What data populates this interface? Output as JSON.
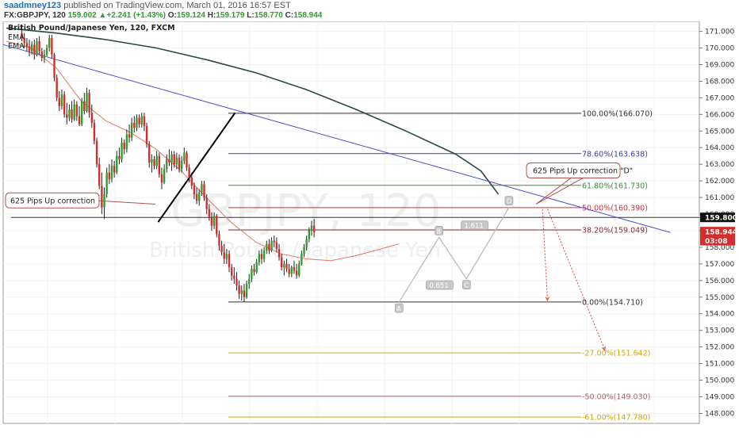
{
  "header": {
    "author": "saadmney123",
    "published": "published on TradingView.com, March 01, 2016 16:57 EST",
    "symbol_tf": "FX:GBPJPY, 120",
    "price": "159.002",
    "change": "+2.241 (+1.43%)",
    "open_label": "O:",
    "open": "159.124",
    "high_label": "H:",
    "high": "159.179",
    "low_label": "L:",
    "low": "158.770",
    "close_label": "C:",
    "close": "158.944"
  },
  "chart_data": {
    "type": "candlestick",
    "title": "British Pound/Japanese Yen, 120, FXCM",
    "legend": [
      "EMA",
      "EMA"
    ],
    "watermark": {
      "main": "GBPJPY, 120",
      "sub": "British Pound / Japanese Yen"
    },
    "ylim": [
      147.4,
      171.6
    ],
    "yticks": [
      148,
      149,
      150,
      151,
      152,
      153,
      154,
      155,
      156,
      157,
      158,
      159,
      160,
      161,
      162,
      163,
      164,
      165,
      166,
      167,
      168,
      169,
      170,
      171
    ],
    "ytick_labels": [
      "148.000",
      "149.000",
      "150.000",
      "151.000",
      "152.000",
      "153.000",
      "154.000",
      "155.000",
      "156.000",
      "157.000",
      "158.000",
      "159.000",
      "160.000",
      "161.000",
      "162.000",
      "163.000",
      "164.000",
      "165.000",
      "166.000",
      "167.000",
      "168.000",
      "169.000",
      "170.000",
      "171.000"
    ],
    "price_tags": [
      {
        "value": 159.8,
        "label": "159.800",
        "style": "black"
      },
      {
        "value": 158.944,
        "label": "158.944",
        "style": "red"
      },
      {
        "value": 158.4,
        "label": "03:08",
        "style": "red"
      }
    ],
    "candles": [
      [
        170.9,
        171.4,
        170.4,
        170.6
      ],
      [
        170.6,
        170.9,
        170.0,
        170.3
      ],
      [
        170.3,
        170.6,
        169.8,
        170.1
      ],
      [
        170.1,
        170.5,
        169.5,
        169.8
      ],
      [
        169.8,
        170.4,
        169.6,
        170.2
      ],
      [
        170.2,
        170.5,
        169.3,
        169.6
      ],
      [
        169.6,
        170.6,
        169.5,
        170.4
      ],
      [
        170.4,
        170.7,
        169.6,
        169.8
      ],
      [
        169.8,
        170.0,
        169.2,
        169.4
      ],
      [
        169.4,
        169.9,
        169.1,
        169.6
      ],
      [
        169.6,
        170.2,
        169.5,
        170.0
      ],
      [
        170.0,
        170.8,
        169.8,
        170.6
      ],
      [
        170.6,
        170.8,
        169.4,
        169.6
      ],
      [
        169.6,
        169.7,
        168.0,
        168.2
      ],
      [
        168.2,
        168.4,
        166.8,
        167.0
      ],
      [
        167.0,
        167.4,
        166.2,
        166.5
      ],
      [
        166.5,
        167.5,
        166.3,
        167.2
      ],
      [
        167.2,
        167.4,
        165.8,
        166.0
      ],
      [
        166.0,
        166.7,
        165.4,
        165.8
      ],
      [
        165.8,
        166.6,
        165.6,
        166.3
      ],
      [
        166.3,
        166.8,
        165.5,
        165.7
      ],
      [
        165.7,
        166.9,
        165.6,
        166.6
      ],
      [
        166.6,
        166.8,
        165.6,
        165.9
      ],
      [
        165.9,
        166.5,
        165.3,
        165.4
      ],
      [
        165.4,
        167.0,
        165.3,
        166.8
      ],
      [
        166.8,
        167.3,
        166.0,
        166.2
      ],
      [
        166.2,
        167.6,
        166.1,
        167.3
      ],
      [
        167.3,
        167.5,
        165.8,
        166.1
      ],
      [
        166.1,
        166.6,
        165.2,
        165.5
      ],
      [
        165.5,
        165.7,
        164.2,
        164.4
      ],
      [
        164.4,
        164.6,
        162.8,
        163.0
      ],
      [
        163.0,
        163.4,
        161.5,
        161.7
      ],
      [
        161.7,
        162.5,
        160.0,
        160.4
      ],
      [
        160.4,
        161.6,
        159.7,
        161.2
      ],
      [
        161.2,
        162.8,
        161.0,
        162.5
      ],
      [
        162.5,
        163.0,
        161.8,
        162.1
      ],
      [
        162.1,
        163.3,
        161.9,
        162.9
      ],
      [
        162.9,
        163.2,
        162.2,
        162.5
      ],
      [
        162.5,
        163.8,
        162.4,
        163.5
      ],
      [
        163.5,
        164.0,
        163.0,
        163.3
      ],
      [
        163.3,
        164.6,
        163.1,
        164.3
      ],
      [
        164.3,
        164.5,
        163.6,
        163.9
      ],
      [
        163.9,
        165.1,
        163.7,
        164.8
      ],
      [
        164.8,
        165.4,
        164.3,
        164.6
      ],
      [
        164.6,
        165.8,
        164.4,
        165.5
      ],
      [
        165.5,
        165.9,
        164.9,
        165.2
      ],
      [
        165.2,
        166.0,
        165.0,
        165.8
      ],
      [
        165.8,
        166.0,
        165.2,
        165.4
      ],
      [
        165.4,
        166.1,
        165.2,
        165.9
      ],
      [
        165.9,
        166.1,
        165.0,
        165.3
      ],
      [
        165.3,
        165.5,
        164.0,
        164.2
      ],
      [
        164.2,
        164.4,
        162.8,
        163.1
      ],
      [
        163.1,
        163.6,
        162.5,
        163.3
      ],
      [
        163.3,
        163.5,
        162.7,
        162.9
      ],
      [
        162.9,
        163.8,
        162.7,
        163.5
      ],
      [
        163.5,
        163.7,
        162.2,
        162.4
      ],
      [
        162.4,
        162.8,
        161.5,
        161.9
      ],
      [
        161.9,
        163.0,
        161.8,
        162.7
      ],
      [
        162.7,
        163.6,
        162.5,
        163.3
      ],
      [
        163.3,
        163.9,
        162.9,
        163.1
      ],
      [
        163.1,
        163.8,
        162.6,
        163.6
      ],
      [
        163.6,
        163.8,
        162.8,
        163.0
      ],
      [
        163.0,
        163.7,
        162.7,
        163.4
      ],
      [
        163.4,
        163.6,
        162.5,
        162.7
      ],
      [
        162.7,
        163.5,
        162.5,
        163.2
      ],
      [
        163.2,
        164.0,
        163.0,
        163.7
      ],
      [
        163.7,
        163.8,
        162.6,
        162.8
      ],
      [
        162.8,
        163.0,
        161.9,
        162.2
      ],
      [
        162.2,
        162.5,
        161.5,
        161.7
      ],
      [
        161.7,
        161.9,
        160.9,
        161.2
      ],
      [
        161.2,
        161.6,
        160.6,
        160.8
      ],
      [
        160.8,
        161.5,
        160.5,
        161.3
      ],
      [
        161.3,
        162.0,
        161.1,
        161.8
      ],
      [
        161.8,
        162.0,
        160.8,
        161.0
      ],
      [
        161.0,
        161.2,
        160.0,
        160.3
      ],
      [
        160.3,
        160.6,
        159.6,
        159.8
      ],
      [
        159.8,
        160.1,
        159.0,
        159.3
      ],
      [
        159.3,
        160.1,
        159.1,
        159.9
      ],
      [
        159.9,
        160.0,
        158.6,
        158.8
      ],
      [
        158.8,
        159.0,
        157.8,
        158.1
      ],
      [
        158.1,
        158.4,
        157.5,
        157.7
      ],
      [
        157.7,
        158.2,
        157.0,
        157.3
      ],
      [
        157.3,
        157.9,
        157.0,
        157.6
      ],
      [
        157.6,
        157.8,
        156.5,
        156.8
      ],
      [
        156.8,
        157.0,
        156.0,
        156.3
      ],
      [
        156.3,
        156.8,
        155.8,
        156.1
      ],
      [
        156.1,
        156.5,
        155.4,
        155.7
      ],
      [
        155.7,
        156.0,
        154.9,
        155.2
      ],
      [
        155.2,
        155.7,
        154.8,
        155.4
      ],
      [
        155.4,
        155.8,
        154.7,
        155.0
      ],
      [
        155.0,
        156.0,
        154.9,
        155.8
      ],
      [
        155.8,
        156.4,
        155.5,
        156.1
      ],
      [
        156.1,
        156.9,
        155.9,
        156.7
      ],
      [
        156.7,
        157.0,
        156.3,
        156.5
      ],
      [
        156.5,
        157.3,
        156.4,
        157.1
      ],
      [
        157.1,
        157.8,
        156.9,
        157.6
      ],
      [
        157.6,
        157.9,
        157.0,
        157.3
      ],
      [
        157.3,
        158.0,
        157.1,
        157.8
      ],
      [
        157.8,
        158.4,
        157.6,
        158.2
      ],
      [
        158.2,
        158.5,
        157.6,
        157.8
      ],
      [
        157.8,
        158.6,
        157.7,
        158.4
      ],
      [
        158.4,
        158.7,
        158.0,
        158.3
      ],
      [
        158.3,
        158.6,
        157.7,
        157.9
      ],
      [
        157.9,
        158.2,
        157.2,
        157.4
      ],
      [
        157.4,
        157.6,
        156.6,
        156.8
      ],
      [
        156.8,
        157.2,
        156.3,
        157.0
      ],
      [
        157.0,
        157.3,
        156.5,
        156.7
      ],
      [
        156.7,
        157.0,
        156.2,
        156.4
      ],
      [
        156.4,
        156.9,
        156.2,
        156.8
      ],
      [
        156.8,
        157.2,
        156.4,
        156.6
      ],
      [
        156.6,
        157.0,
        156.1,
        156.3
      ],
      [
        156.3,
        157.2,
        156.2,
        157.0
      ],
      [
        157.0,
        157.8,
        156.9,
        157.6
      ],
      [
        157.6,
        158.2,
        157.4,
        158.0
      ],
      [
        158.0,
        158.7,
        157.8,
        158.5
      ],
      [
        158.5,
        159.2,
        158.3,
        159.0
      ],
      [
        159.0,
        159.6,
        158.7,
        159.3
      ],
      [
        159.3,
        159.7,
        158.6,
        158.9
      ]
    ],
    "ema_200": [
      [
        0,
        171.2
      ],
      [
        20,
        170.9
      ],
      [
        40,
        170.5
      ],
      [
        60,
        170.0
      ],
      [
        80,
        169.3
      ],
      [
        100,
        168.5
      ],
      [
        120,
        167.5
      ],
      [
        140,
        166.3
      ],
      [
        160,
        165.0
      ],
      [
        180,
        163.6
      ],
      [
        190,
        162.6
      ],
      [
        197,
        161.2
      ]
    ],
    "ema_50": [
      [
        0,
        170.4
      ],
      [
        10,
        170.0
      ],
      [
        20,
        168.8
      ],
      [
        30,
        166.8
      ],
      [
        40,
        165.6
      ],
      [
        50,
        164.9
      ],
      [
        60,
        163.9
      ],
      [
        70,
        162.6
      ],
      [
        80,
        161.0
      ],
      [
        90,
        159.5
      ],
      [
        100,
        158.3
      ],
      [
        110,
        157.6
      ],
      [
        120,
        157.3
      ],
      [
        130,
        157.2
      ],
      [
        140,
        157.5
      ],
      [
        150,
        157.9
      ],
      [
        157,
        158.2
      ]
    ],
    "trendline": {
      "from": [
        0,
        170.2
      ],
      "to": [
        230,
        158.7
      ]
    },
    "support_line": {
      "from": [
        0,
        159.8
      ],
      "to": [
        230,
        159.8
      ]
    },
    "uptrend": {
      "from": [
        43,
        159.9
      ],
      "to": [
        70,
        166.1
      ]
    },
    "fib_levels": [
      {
        "value": 166.07,
        "label": "100.00%(166.070)",
        "color": "#333333"
      },
      {
        "value": 163.638,
        "label": "78.60%(163.638)",
        "color": "#3c3ca8"
      },
      {
        "value": 161.73,
        "label": "61.80%(161.730)",
        "color": "#3a8a3a"
      },
      {
        "value": 160.39,
        "label": "50.00%(160.390)",
        "color": "#cc3333"
      },
      {
        "value": 159.049,
        "label": "38.20%(159.049)",
        "color": "#8a2a2a"
      },
      {
        "value": 154.71,
        "label": "0.00%(154.710)",
        "color": "#333333"
      },
      {
        "value": 151.642,
        "label": "-27.00%(151.642)",
        "color": "#d9a400"
      },
      {
        "value": 149.03,
        "label": "-50.00%(149.030)",
        "color": "#b06060"
      },
      {
        "value": 147.78,
        "label": "-61.00%(147.780)",
        "color": "#d9a400"
      }
    ],
    "harmonic": {
      "points": [
        {
          "label": "A",
          "x": 122,
          "y": 154.7
        },
        {
          "label": "B",
          "x": 138,
          "y": 158.6
        },
        {
          "label": "C",
          "x": 149,
          "y": 156.1
        },
        {
          "label": "D",
          "x": 166,
          "y": 160.4
        }
      ],
      "ratios": [
        {
          "label": "0.651",
          "x": 136,
          "y": 155.7
        },
        {
          "label": "1.611",
          "x": 150,
          "y": 159.3
        }
      ]
    },
    "projection_arrows": [
      {
        "from": [
          168,
          160.3
        ],
        "to": [
          170,
          154.8
        ]
      },
      {
        "from": [
          170,
          160.3
        ],
        "to": [
          193,
          151.8
        ]
      }
    ],
    "callouts": [
      {
        "text": "625 Pips Up correction",
        "target": [
          47,
          160.8
        ]
      },
      {
        "text": "625 Pips Up correction  \"D\"",
        "target": [
          167,
          160.7
        ]
      }
    ]
  },
  "colors": {
    "up": "#2e9e2e",
    "down": "#d62c2c",
    "ema200": "#2a4a38",
    "ema50": "#e07a5f",
    "trendline": "#4a4acc",
    "author": "#1e6fb8"
  }
}
